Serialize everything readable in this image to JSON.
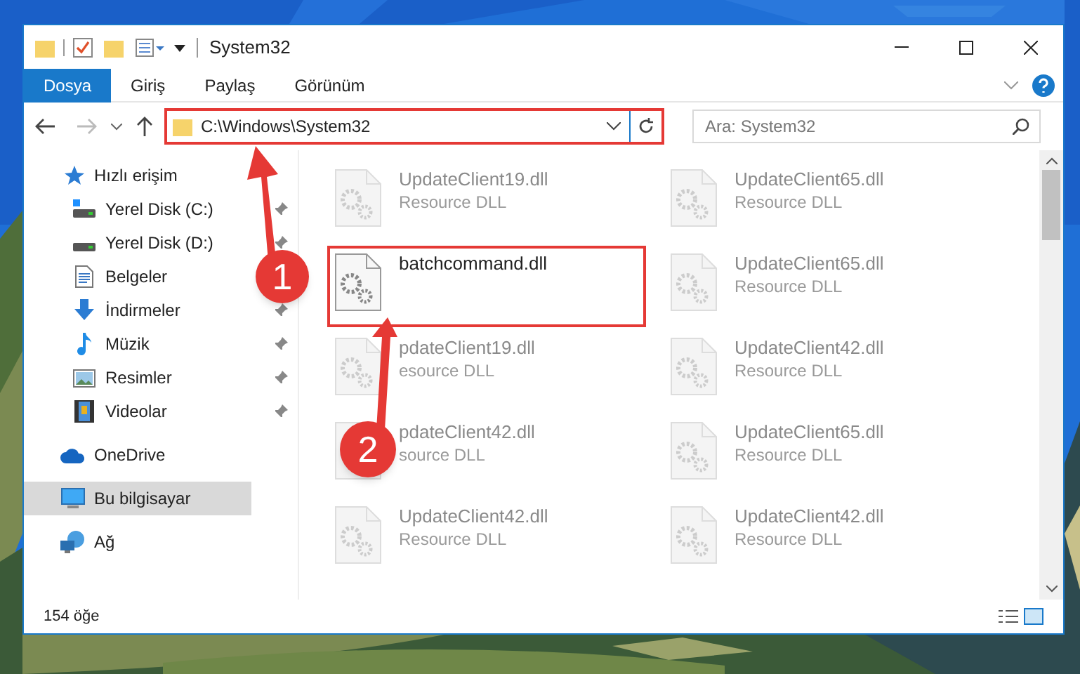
{
  "window": {
    "title": "System32"
  },
  "ribbon_tabs": [
    {
      "label": "Dosya",
      "selected": true
    },
    {
      "label": "Giriş",
      "selected": false
    },
    {
      "label": "Paylaş",
      "selected": false
    },
    {
      "label": "Görünüm",
      "selected": false
    }
  ],
  "address": {
    "path": "C:\\Windows\\System32",
    "highlighted": true
  },
  "search": {
    "placeholder": "Ara: System32"
  },
  "sidebar": {
    "items": [
      {
        "label": "Hızlı erişim",
        "kind": "star",
        "selected": false,
        "pinned": false,
        "children": [
          {
            "label": "Yerel Disk (C:)",
            "kind": "drive-c",
            "selected": false,
            "pinned": true
          },
          {
            "label": "Yerel Disk (D:)",
            "kind": "drive",
            "selected": false,
            "pinned": true
          },
          {
            "label": "Belgeler",
            "kind": "document",
            "selected": false,
            "pinned": false
          },
          {
            "label": "İndirmeler",
            "kind": "download",
            "selected": false,
            "pinned": true
          },
          {
            "label": "Müzik",
            "kind": "music",
            "selected": false,
            "pinned": true
          },
          {
            "label": "Resimler",
            "kind": "pictures",
            "selected": false,
            "pinned": true
          },
          {
            "label": "Videolar",
            "kind": "video",
            "selected": false,
            "pinned": true
          }
        ]
      },
      {
        "label": "OneDrive",
        "kind": "cloud",
        "selected": false,
        "pinned": false
      },
      {
        "label": "Bu bilgisayar",
        "kind": "computer",
        "selected": true,
        "pinned": false
      },
      {
        "label": "Ağ",
        "kind": "network",
        "selected": false,
        "pinned": false
      }
    ]
  },
  "files": [
    {
      "name": "UpdateClient19.dll",
      "type": "Resource DLL",
      "blurred": true,
      "highlighted": false
    },
    {
      "name": "UpdateClient65.dll",
      "type": "Resource DLL",
      "blurred": true,
      "highlighted": false
    },
    {
      "name": "batchcommand.dll",
      "blurred": false,
      "highlighted": true
    },
    {
      "name": "UpdateClient65.dll",
      "type": "Resource DLL",
      "blurred": true,
      "highlighted": false
    },
    {
      "name": "pdateClient19.dll",
      "type": "esource DLL",
      "blurred": true,
      "highlighted": false
    },
    {
      "name": "UpdateClient42.dll",
      "type": "Resource DLL",
      "blurred": true,
      "highlighted": false
    },
    {
      "name": "pdateClient42.dll",
      "type": "source DLL",
      "blurred": true,
      "highlighted": false
    },
    {
      "name": "UpdateClient65.dll",
      "type": "Resource DLL",
      "blurred": true,
      "highlighted": false
    },
    {
      "name": "UpdateClient42.dll",
      "type": "Resource DLL",
      "blurred": true,
      "highlighted": false
    },
    {
      "name": "UpdateClient42.dll",
      "type": "Resource DLL",
      "blurred": true,
      "highlighted": false
    }
  ],
  "status_bar": {
    "item_count": "154 öğe"
  },
  "annotations": [
    {
      "number": "1"
    },
    {
      "number": "2"
    }
  ]
}
